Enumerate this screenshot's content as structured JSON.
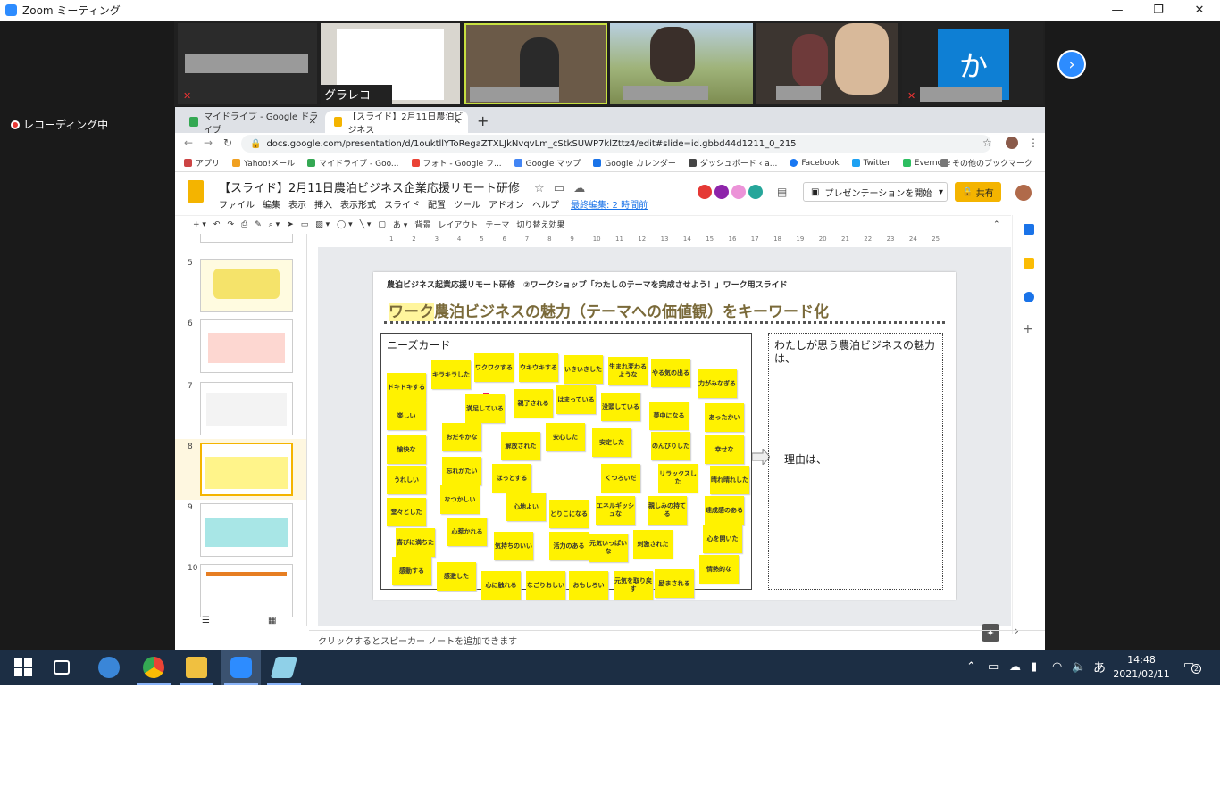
{
  "zoom": {
    "window_title": "Zoom ミーティング",
    "recording_label": "レコーディング中",
    "participants": [
      {
        "name": ""
      },
      {
        "name": "グラレコ"
      },
      {
        "name": ""
      },
      {
        "name": ""
      },
      {
        "name": ""
      },
      {
        "name": "か"
      }
    ]
  },
  "browser": {
    "tabs": [
      {
        "label": "マイドライブ - Google ドライブ"
      },
      {
        "label": "【スライド】2月11日農泊ビジネス"
      }
    ],
    "url": "docs.google.com/presentation/d/1ouktllYToRegaZTXLJkNvqvLm_cStkSUWP7klZttz4/edit#slide=id.gbbd44d1211_0_215",
    "bookmarks": [
      "アプリ",
      "Yahoo!メール",
      "マイドライブ - Goo...",
      "フォト - Google フ...",
      "Google マップ",
      "Google カレンダー",
      "ダッシュボード ‹ a...",
      "Facebook",
      "Twitter",
      "Evernote"
    ],
    "other_bookmarks": "その他のブックマーク"
  },
  "slides": {
    "doc_title": "【スライド】2月11日農泊ビジネス企業応援リモート研修",
    "menu": [
      "ファイル",
      "編集",
      "表示",
      "挿入",
      "表示形式",
      "スライド",
      "配置",
      "ツール",
      "アドオン",
      "ヘルプ"
    ],
    "last_edit": "最終編集: 2 時間前",
    "present_label": "プレゼンテーションを開始",
    "share_label": "共有",
    "toolbar": [
      "背景",
      "レイアウト",
      "テーマ",
      "切り替え効果"
    ],
    "notes_placeholder": "クリックするとスピーカー ノートを追加できます",
    "thumbnails": [
      {
        "num": "5"
      },
      {
        "num": "6"
      },
      {
        "num": "7"
      },
      {
        "num": "8"
      },
      {
        "num": "9"
      },
      {
        "num": "10"
      }
    ],
    "ruler_ticks": [
      "1",
      "2",
      "3",
      "4",
      "5",
      "6",
      "7",
      "8",
      "9",
      "10",
      "11",
      "12",
      "13",
      "14",
      "15",
      "16",
      "17",
      "18",
      "19",
      "20",
      "21",
      "22",
      "23",
      "24",
      "25"
    ]
  },
  "slide": {
    "header": "農泊ビジネス起業応援リモート研修　②ワークショップ「わたしのテーマを完成させよう！」ワーク用スライド",
    "title_highlight": "ワーク",
    "title_rest": "農泊ビジネスの魅力（テーマへの価値観）をキーワード化",
    "needs_label": "ニーズカード",
    "right_text": "わたしが思う農泊ビジネスの魅力は、",
    "reason": "理由は、",
    "stickies": [
      "ドキドキする",
      "キラキラした",
      "ワクワクする",
      "ウキウキする",
      "いきいきした",
      "生まれ変わるような",
      "やる気の出る",
      "力がみなぎる",
      "満足している",
      "親了される",
      "はまっている",
      "没頭している",
      "夢中になる",
      "あったかい",
      "楽しい",
      "おだやかな",
      "解放された",
      "安心した",
      "安定した",
      "のんびりした",
      "幸せな",
      "愉快な",
      "忘れがたい",
      "ほっとする",
      "くつろいだ",
      "リラックスした",
      "晴れ晴れした",
      "うれしい",
      "なつかしい",
      "心地よい",
      "とりこになる",
      "エネルギッシュな",
      "親しみの持てる",
      "達成感のある",
      "堂々とした",
      "心惹かれる",
      "気持ちのいい",
      "活力のある",
      "元気いっぱいな",
      "刺激された",
      "心を開いた",
      "喜びに満ちた",
      "感動する",
      "感激した",
      "心に触れる",
      "なごりおしい",
      "おもしろい",
      "元気を取り戻す",
      "励まされる",
      "情熱的な"
    ]
  },
  "taskbar": {
    "time": "14:48",
    "date": "2021/02/11",
    "ime": "あ",
    "notif_count": "2"
  }
}
